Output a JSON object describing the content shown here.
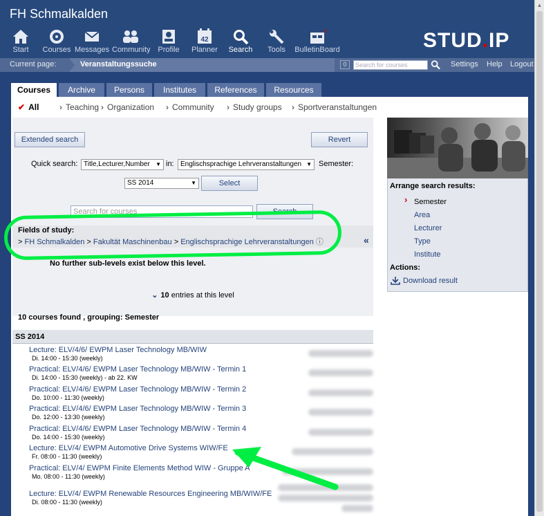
{
  "header": {
    "site_title": "FH Schmalkalden",
    "logo_text_1": "STUD",
    "logo_dot": ".",
    "logo_text_2": "IP",
    "nav": [
      {
        "label": "Start",
        "icon": "house-icon"
      },
      {
        "label": "Courses",
        "icon": "courses-icon"
      },
      {
        "label": "Messages",
        "icon": "envelope-icon"
      },
      {
        "label": "Community",
        "icon": "people-icon"
      },
      {
        "label": "Profile",
        "icon": "profile-icon"
      },
      {
        "label": "Planner",
        "icon": "calendar-icon",
        "badge": "42"
      },
      {
        "label": "Search",
        "icon": "magnifier-icon"
      },
      {
        "label": "Tools",
        "icon": "wrench-icon"
      },
      {
        "label": "BulletinBoard",
        "icon": "bulletin-icon"
      }
    ]
  },
  "crumb": {
    "label": "Current page:",
    "current": "Veranstaltungssuche",
    "badge": "0",
    "search_placeholder": "Search for courses",
    "links": [
      "Settings",
      "Help",
      "Logout"
    ]
  },
  "tabs": [
    "Courses",
    "Archive",
    "Persons",
    "Institutes",
    "References",
    "Resources"
  ],
  "subnav": [
    "All",
    "Teaching",
    "Organization",
    "Community",
    "Study groups",
    "Sportveranstaltungen"
  ],
  "form": {
    "extended_search": "Extended search",
    "revert": "Revert",
    "quick_search_label": "Quick search:",
    "quick_search_value": "Title,Lecturer,Number",
    "in_label": "in:",
    "in_value": "Englischsprachige Lehrveranstaltungen",
    "semester_label": "Semester:",
    "semester_value": "SS 2014",
    "select_button": "Select",
    "search_placeholder": "Search for courses",
    "search_button": "Search"
  },
  "fields_of_study": {
    "title": "Fields of study:",
    "path_prefix": ">",
    "path_1": "FH Schmalkalden",
    "sep": ">",
    "path_2": "Fakultät Maschinenbau",
    "path_3": "Englischsprachige Lehrveranstaltungen",
    "info_icon": "ⓘ",
    "collapse_icon": "«"
  },
  "no_sublevels": "No further sub-levels exist below this level.",
  "entries": {
    "count": "10",
    "text": " entries at this level"
  },
  "found": "10 courses found , grouping: Semester",
  "group_title": "SS 2014",
  "courses": [
    {
      "title": "Lecture: ELV/4/6/ EWPM Laser Technology MB/WIW",
      "date": "Di. 14:00 - 15:30 (weekly)"
    },
    {
      "title": "Practical: ELV/4/6/ EWPM Laser Technology MB/WIW - Termin 1",
      "date": "Di. 14:00 - 15:30 (weekly) - ab 22. KW"
    },
    {
      "title": "Practical: ELV/4/6/ EWPM Laser Technology MB/WIW - Termin 2",
      "date": "Do. 10:00 - 11:30 (weekly)"
    },
    {
      "title": "Practical: ELV/4/6/ EWPM Laser Technology MB/WIW - Termin 3",
      "date": "Do. 12:00 - 13:30 (weekly)"
    },
    {
      "title": "Practical: ELV/4/6/ EWPM Laser Technology MB/WIW - Termin 4",
      "date": "Do. 14:00 - 15:30 (weekly)"
    },
    {
      "title": "Lecture: ELV/4/ EWPM Automotive Drive Systems WIW/FE",
      "date": "Fr. 08:00 - 11:30 (weekly)"
    },
    {
      "title": "Practical: ELV/4/ EWPM Finite Elements Method WIW - Gruppe A",
      "date": "Mo. 08:00 - 11:30 (weekly)"
    },
    {
      "title": "Lecture: ELV/4/ EWPM Renewable Resources Engineering MB/WIW/FE",
      "date": "Di. 08:00 - 11:30 (weekly)"
    }
  ],
  "sidebar": {
    "arrange_title": "Arrange search results:",
    "items": [
      "Semester",
      "Area",
      "Lecturer",
      "Type",
      "Institute"
    ],
    "actions_title": "Actions:",
    "download": "Download result"
  },
  "colors": {
    "brand": "#28497c",
    "accent": "#d60000",
    "annotation": "#00ee44"
  }
}
